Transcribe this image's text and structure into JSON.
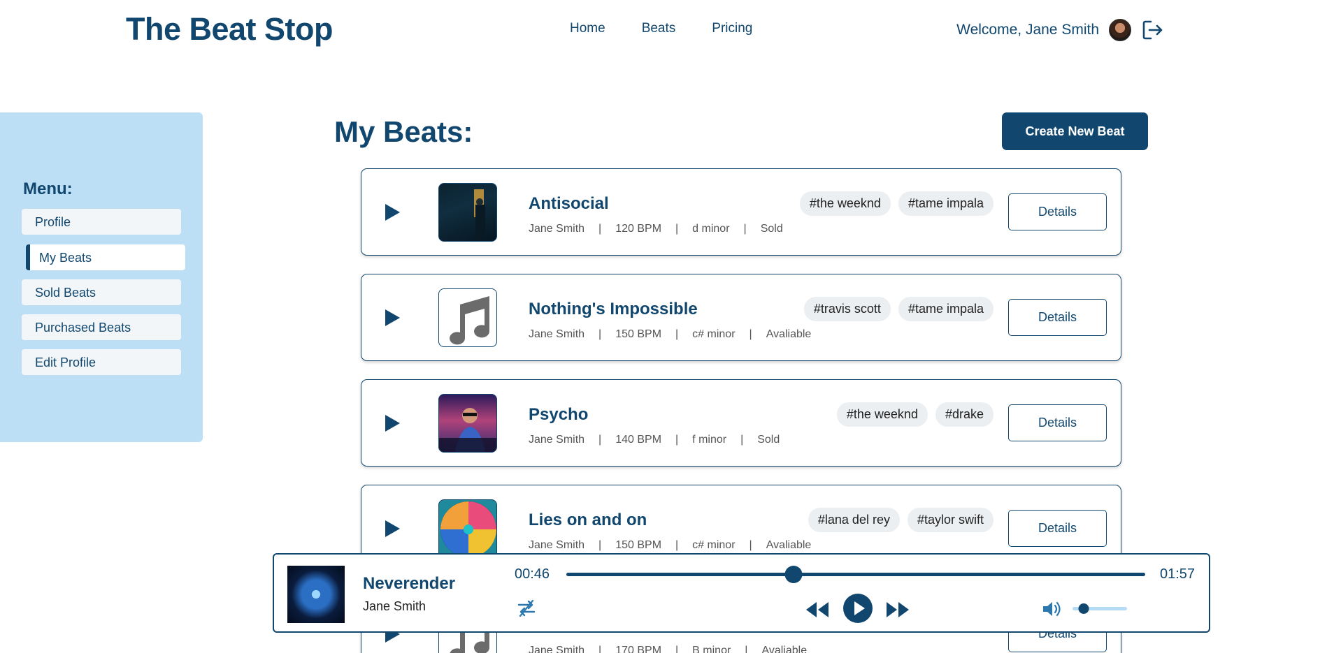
{
  "header": {
    "logo": "The Beat Stop",
    "nav": [
      {
        "label": "Home"
      },
      {
        "label": "Beats"
      },
      {
        "label": "Pricing"
      }
    ],
    "welcome": "Welcome, Jane Smith"
  },
  "sidebar": {
    "title": "Menu:",
    "items": [
      {
        "label": "Profile",
        "active": false
      },
      {
        "label": "My Beats",
        "active": true
      },
      {
        "label": "Sold Beats",
        "active": false
      },
      {
        "label": "Purchased Beats",
        "active": false
      },
      {
        "label": "Edit Profile",
        "active": false
      }
    ]
  },
  "main": {
    "title": "My Beats:",
    "create_button": "Create New Beat",
    "details_label": "Details",
    "beats": [
      {
        "title": "Antisocial",
        "artist": "Jane Smith",
        "bpm": "120 BPM",
        "key": "d minor",
        "status": "Sold",
        "tags": [
          "#the weeknd",
          "#tame impala"
        ]
      },
      {
        "title": "Nothing's Impossible",
        "artist": "Jane Smith",
        "bpm": "150 BPM",
        "key": "c# minor",
        "status": "Avaliable",
        "tags": [
          "#travis scott",
          "#tame impala"
        ]
      },
      {
        "title": "Psycho",
        "artist": "Jane Smith",
        "bpm": "140 BPM",
        "key": "f minor",
        "status": "Sold",
        "tags": [
          "#the weeknd",
          "#drake"
        ]
      },
      {
        "title": "Lies on and on",
        "artist": "Jane Smith",
        "bpm": "150 BPM",
        "key": "c# minor",
        "status": "Avaliable",
        "tags": [
          "#lana del rey",
          "#taylor swift"
        ]
      },
      {
        "title": "",
        "artist": "Jane Smith",
        "bpm": "170 BPM",
        "key": "B minor",
        "status": "Avaliable",
        "tags": []
      }
    ]
  },
  "player": {
    "title": "Neverender",
    "artist": "Jane Smith",
    "current_time": "00:46",
    "total_time": "01:57",
    "progress": 0.393,
    "volume": 0.2
  }
}
